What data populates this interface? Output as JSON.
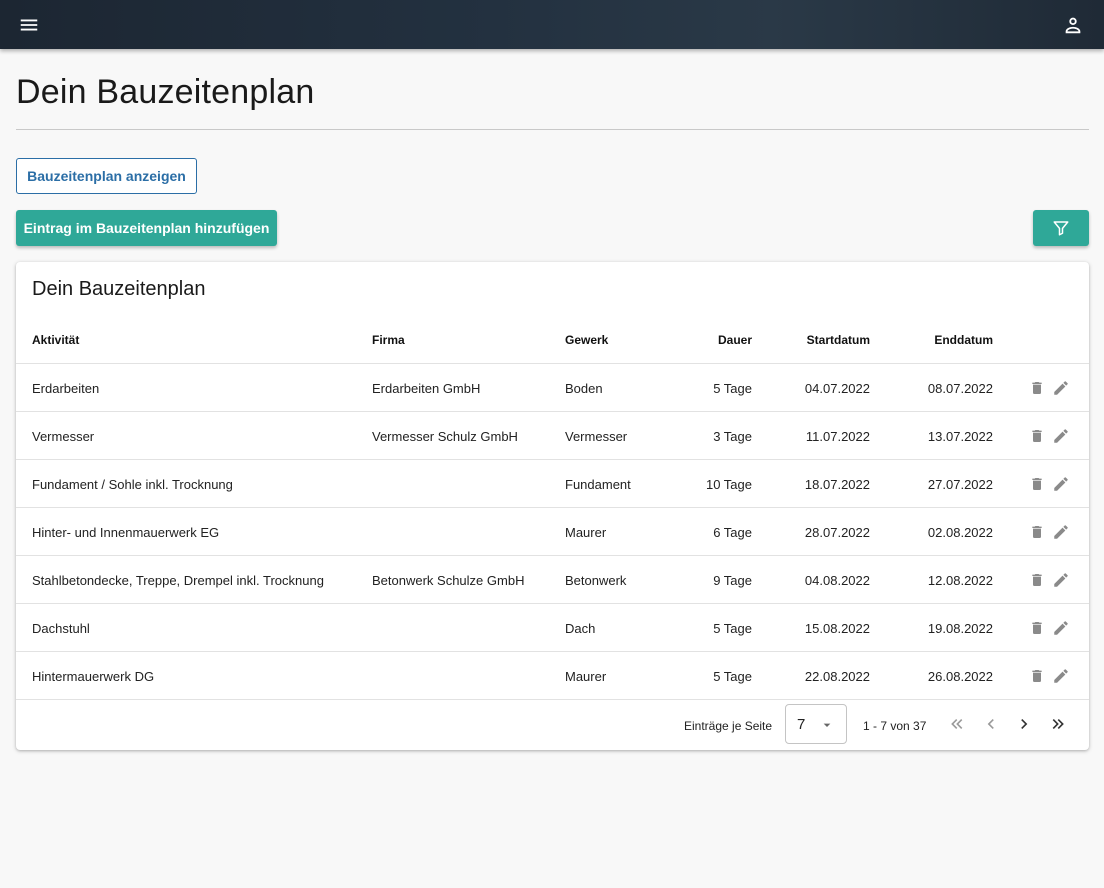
{
  "header": {
    "menu_icon": "menu-icon",
    "account_icon": "account-icon"
  },
  "page": {
    "title": "Dein Bauzeitenplan"
  },
  "actions": {
    "show_plan_label": "Bauzeitenplan anzeigen",
    "add_entry_label": "Eintrag im Bauzeitenplan hinzufügen",
    "filter_icon": "filter-icon"
  },
  "colors": {
    "primary": "#2fa898",
    "outline_blue": "#2b6ea6",
    "header_bg": "#233140"
  },
  "table": {
    "title": "Dein Bauzeitenplan",
    "columns": {
      "aktivitaet": "Aktivität",
      "firma": "Firma",
      "gewerk": "Gewerk",
      "dauer": "Dauer",
      "startdatum": "Startdatum",
      "enddatum": "Enddatum"
    },
    "rows": [
      {
        "aktivitaet": "Erdarbeiten",
        "firma": "Erdarbeiten GmbH",
        "gewerk": "Boden",
        "dauer": "5 Tage",
        "start": "04.07.2022",
        "end": "08.07.2022"
      },
      {
        "aktivitaet": "Vermesser",
        "firma": "Vermesser Schulz GmbH",
        "gewerk": "Vermesser",
        "dauer": "3 Tage",
        "start": "11.07.2022",
        "end": "13.07.2022"
      },
      {
        "aktivitaet": "Fundament / Sohle inkl. Trocknung",
        "firma": "",
        "gewerk": "Fundament",
        "dauer": "10 Tage",
        "start": "18.07.2022",
        "end": "27.07.2022"
      },
      {
        "aktivitaet": "Hinter- und Innenmauerwerk EG",
        "firma": "",
        "gewerk": "Maurer",
        "dauer": "6 Tage",
        "start": "28.07.2022",
        "end": "02.08.2022"
      },
      {
        "aktivitaet": "Stahlbetondecke, Treppe, Drempel inkl. Trocknung",
        "firma": "Betonwerk Schulze GmbH",
        "gewerk": "Betonwerk",
        "dauer": "9 Tage",
        "start": "04.08.2022",
        "end": "12.08.2022"
      },
      {
        "aktivitaet": "Dachstuhl",
        "firma": "",
        "gewerk": "Dach",
        "dauer": "5 Tage",
        "start": "15.08.2022",
        "end": "19.08.2022"
      },
      {
        "aktivitaet": "Hintermauerwerk DG",
        "firma": "",
        "gewerk": "Maurer",
        "dauer": "5 Tage",
        "start": "22.08.2022",
        "end": "26.08.2022"
      }
    ],
    "row_icons": {
      "delete": "trash-icon",
      "edit": "pencil-icon"
    }
  },
  "paginator": {
    "page_size_label": "Einträge je Seite",
    "page_size": "7",
    "range_label": "1 - 7 von 37"
  }
}
